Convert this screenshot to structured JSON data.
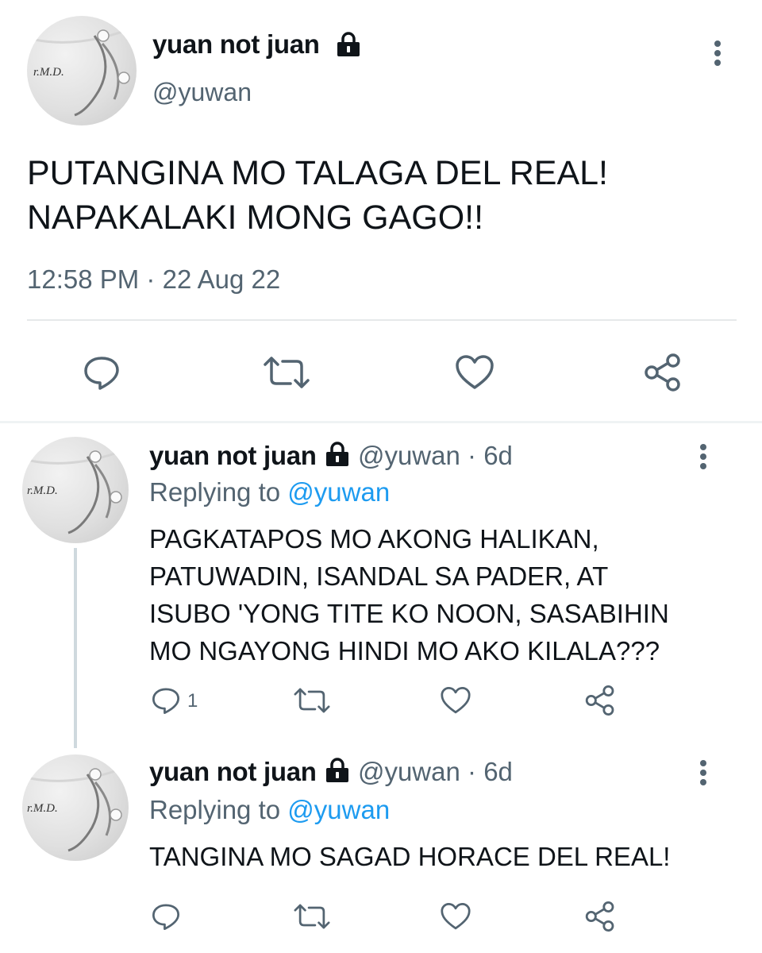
{
  "main_tweet": {
    "display_name": "yuan not juan",
    "handle": "@yuwan",
    "text_line1": "PUTANGINA MO TALAGA DEL REAL!",
    "text_line2": "NAPAKALAKI MONG GAGO!!",
    "time": "12:58 PM",
    "sep": "·",
    "date": "22 Aug 22",
    "avatar_text": "r.M.D."
  },
  "replies": [
    {
      "display_name": "yuan not juan",
      "handle": "@yuwan",
      "sep": "·",
      "age": "6d",
      "replying_prefix": "Replying to",
      "replying_to": "@yuwan",
      "lines": [
        "PAGKATAPOS MO AKONG HALIKAN,",
        "PATUWADIN, ISANDAL SA PADER, AT",
        "ISUBO 'YONG TITE KO NOON, SASABIHIN",
        "MO NGAYONG HINDI MO AKO KILALA???"
      ],
      "reply_count": "1",
      "avatar_text": "r.M.D."
    },
    {
      "display_name": "yuan not juan",
      "handle": "@yuwan",
      "sep": "·",
      "age": "6d",
      "replying_prefix": "Replying to",
      "replying_to": "@yuwan",
      "lines": [
        "TANGINA MO SAGAD HORACE DEL REAL!"
      ],
      "avatar_text": "r.M.D."
    }
  ],
  "icons": {
    "reply": "reply-icon",
    "retweet": "retweet-icon",
    "like": "like-icon",
    "share": "share-icon",
    "more": "more-icon",
    "lock": "lock-icon"
  },
  "colors": {
    "text": "#0f1419",
    "muted": "#536471",
    "link": "#1d9bf0",
    "divider": "#e6e9ea"
  }
}
